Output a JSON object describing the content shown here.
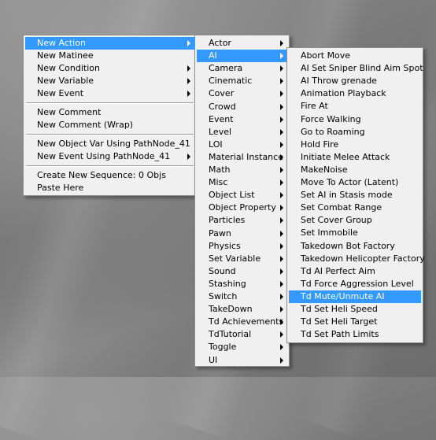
{
  "main_menu": {
    "groups": [
      [
        {
          "label": "New Action",
          "submenu": true,
          "highlighted": true
        },
        {
          "label": "New Matinee",
          "submenu": false
        },
        {
          "label": "New Condition",
          "submenu": true
        },
        {
          "label": "New Variable",
          "submenu": true
        },
        {
          "label": "New Event",
          "submenu": true
        }
      ],
      [
        {
          "label": "New Comment",
          "submenu": false
        },
        {
          "label": "New Comment (Wrap)",
          "submenu": false
        }
      ],
      [
        {
          "label": "New Object Var Using PathNode_41",
          "submenu": false
        },
        {
          "label": "New Event Using PathNode_41",
          "submenu": true
        }
      ],
      [
        {
          "label": "Create New Sequence: 0 Objs",
          "submenu": false
        },
        {
          "label": "Paste Here",
          "submenu": false
        }
      ]
    ]
  },
  "action_menu": {
    "items": [
      {
        "label": "Actor"
      },
      {
        "label": "AI",
        "highlighted": true
      },
      {
        "label": "Camera"
      },
      {
        "label": "Cinematic"
      },
      {
        "label": "Cover"
      },
      {
        "label": "Crowd"
      },
      {
        "label": "Event"
      },
      {
        "label": "Level"
      },
      {
        "label": "LOI"
      },
      {
        "label": "Material Instance"
      },
      {
        "label": "Math"
      },
      {
        "label": "Misc"
      },
      {
        "label": "Object List"
      },
      {
        "label": "Object Property"
      },
      {
        "label": "Particles"
      },
      {
        "label": "Pawn"
      },
      {
        "label": "Physics"
      },
      {
        "label": "Set Variable"
      },
      {
        "label": "Sound"
      },
      {
        "label": "Stashing"
      },
      {
        "label": "Switch"
      },
      {
        "label": "TakeDown"
      },
      {
        "label": "Td Achievements"
      },
      {
        "label": "TdTutorial"
      },
      {
        "label": "Toggle"
      },
      {
        "label": "UI"
      }
    ]
  },
  "ai_menu": {
    "items": [
      {
        "label": "Abort Move"
      },
      {
        "label": "AI Set Sniper Blind Aim Spot"
      },
      {
        "label": "AI Throw grenade"
      },
      {
        "label": "Animation Playback"
      },
      {
        "label": "Fire At"
      },
      {
        "label": "Force Walking"
      },
      {
        "label": "Go to Roaming"
      },
      {
        "label": "Hold Fire"
      },
      {
        "label": "Initiate Melee Attack"
      },
      {
        "label": "MakeNoise"
      },
      {
        "label": "Move To Actor (Latent)"
      },
      {
        "label": "Set AI in Stasis mode"
      },
      {
        "label": "Set Combat Range"
      },
      {
        "label": "Set Cover Group"
      },
      {
        "label": "Set Immobile"
      },
      {
        "label": "Takedown Bot Factory"
      },
      {
        "label": "Takedown Helicopter Factory"
      },
      {
        "label": "Td AI Perfect Aim"
      },
      {
        "label": "Td Force Aggression Level"
      },
      {
        "label": "Td Mute/Unmute AI",
        "highlighted": true
      },
      {
        "label": "Td Set Heli Speed"
      },
      {
        "label": "Td Set Heli Target"
      },
      {
        "label": "Td Set Path Limits"
      }
    ]
  }
}
